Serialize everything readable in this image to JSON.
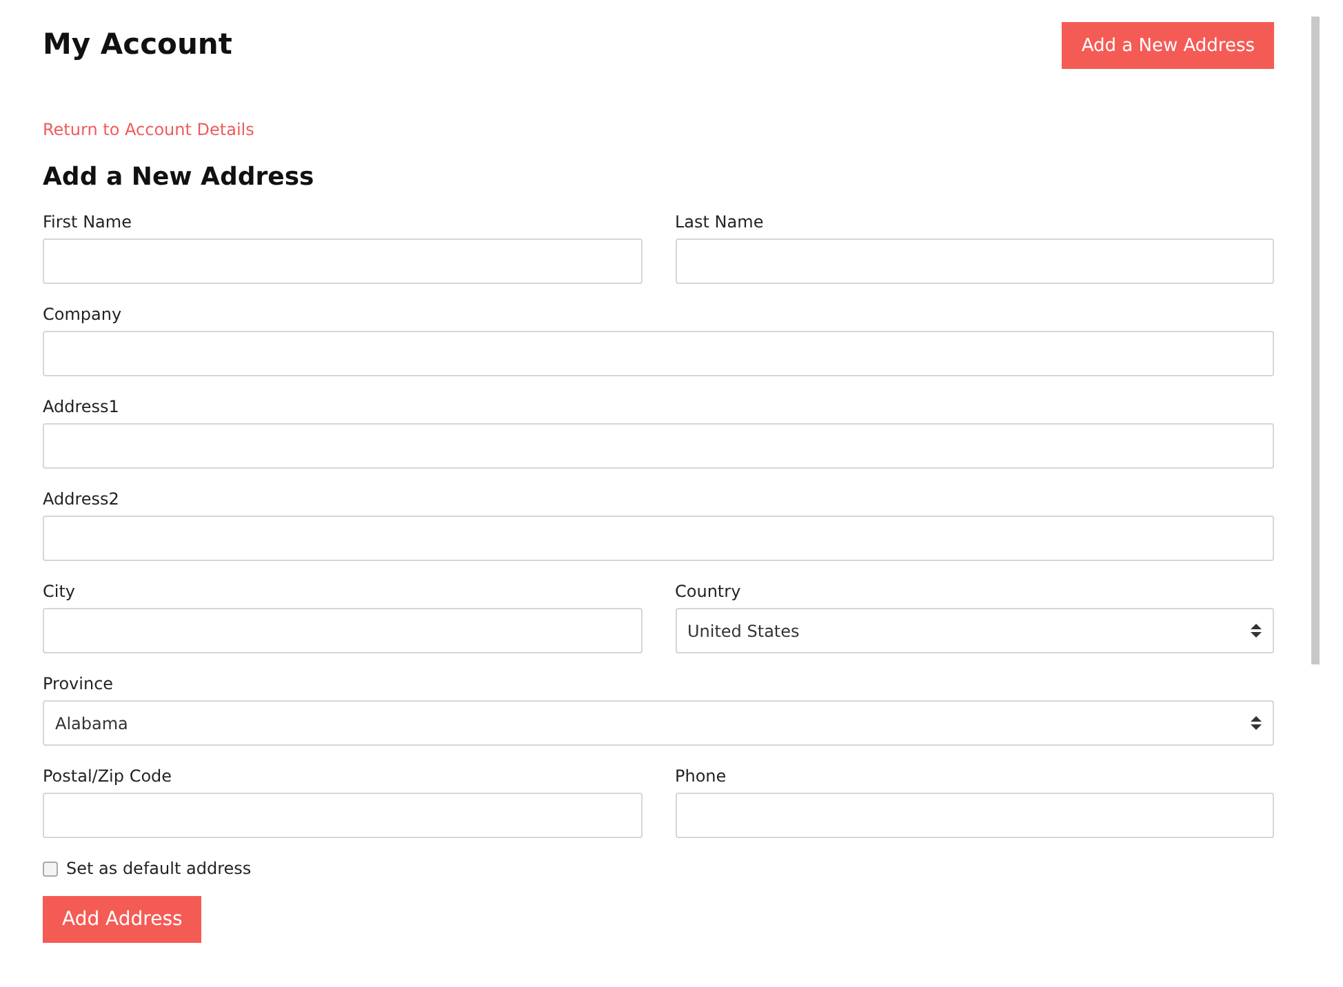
{
  "header": {
    "title": "My Account",
    "action_button": "Add a New Address"
  },
  "back_link": "Return to Account Details",
  "form": {
    "title": "Add a New Address",
    "rows": [
      [
        {
          "label": "First Name",
          "kind": "text"
        },
        {
          "label": "Last Name",
          "kind": "text"
        }
      ],
      [
        {
          "label": "Company",
          "kind": "text"
        }
      ],
      [
        {
          "label": "Address1",
          "kind": "text"
        }
      ],
      [
        {
          "label": "Address2",
          "kind": "text"
        }
      ],
      [
        {
          "label": "City",
          "kind": "text"
        },
        {
          "label": "Country",
          "kind": "select",
          "value": "United States"
        }
      ],
      [
        {
          "label": "Province",
          "kind": "select",
          "value": "Alabama"
        }
      ],
      [
        {
          "label": "Postal/Zip Code",
          "kind": "text"
        },
        {
          "label": "Phone",
          "kind": "text"
        }
      ]
    ],
    "default_checkbox": {
      "label": "Set as default address",
      "checked": false
    },
    "submit_button": "Add Address"
  }
}
